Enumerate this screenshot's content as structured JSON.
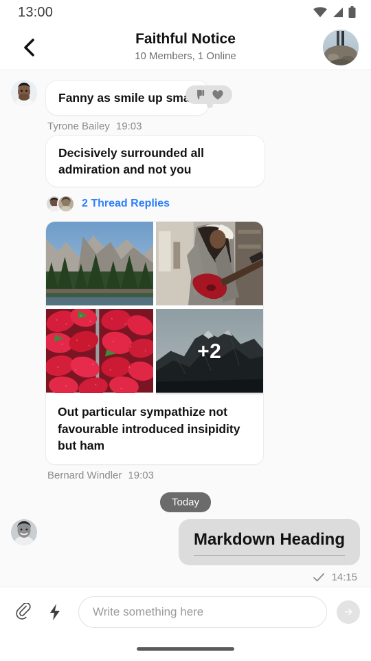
{
  "status_bar": {
    "time": "13:00",
    "icons": [
      "wifi-icon",
      "signal-icon",
      "battery-icon"
    ]
  },
  "header": {
    "back_icon": "chevron-left-icon",
    "title": "Faithful Notice",
    "subtitle": "10 Members, 1 Online",
    "avatar": "group-avatar"
  },
  "messages": [
    {
      "id": "msg-1",
      "author": "Tyrone Bailey",
      "time": "19:03",
      "text": "Fanny as smile up small",
      "reactions": [
        "thumbs-down-icon",
        "heart-icon"
      ]
    },
    {
      "id": "msg-2",
      "author": "Bernard Windler",
      "time": "19:03",
      "text": "Decisively surrounded all admiration and not you",
      "thread": {
        "label": "2 Thread Replies",
        "count": 2
      },
      "media": {
        "items": [
          {
            "name": "photo-forest-mountain"
          },
          {
            "name": "photo-guitar-woman"
          },
          {
            "name": "photo-strawberries"
          },
          {
            "name": "photo-dark-mountain",
            "overlay": "+2"
          }
        ],
        "caption": "Out particular sympathize not favourable introduced insipidity but ham"
      }
    }
  ],
  "day_divider": {
    "label": "Today"
  },
  "outgoing": {
    "heading": "Markdown Heading",
    "time": "14:15",
    "status_icon": "check-icon"
  },
  "composer": {
    "attach_icon": "paperclip-icon",
    "quick_icon": "lightning-bolt-icon",
    "placeholder": "Write something here",
    "value": "",
    "send_icon": "arrow-right-icon"
  },
  "nav_bar": {
    "handle": "home-indicator"
  },
  "colors": {
    "background": "#fafafa",
    "surface": "#ffffff",
    "link": "#2d7ff9",
    "bubble_out": "#dcdcdc",
    "day_pill": "#6b6b6b",
    "muted_text": "#8b8b8b"
  }
}
